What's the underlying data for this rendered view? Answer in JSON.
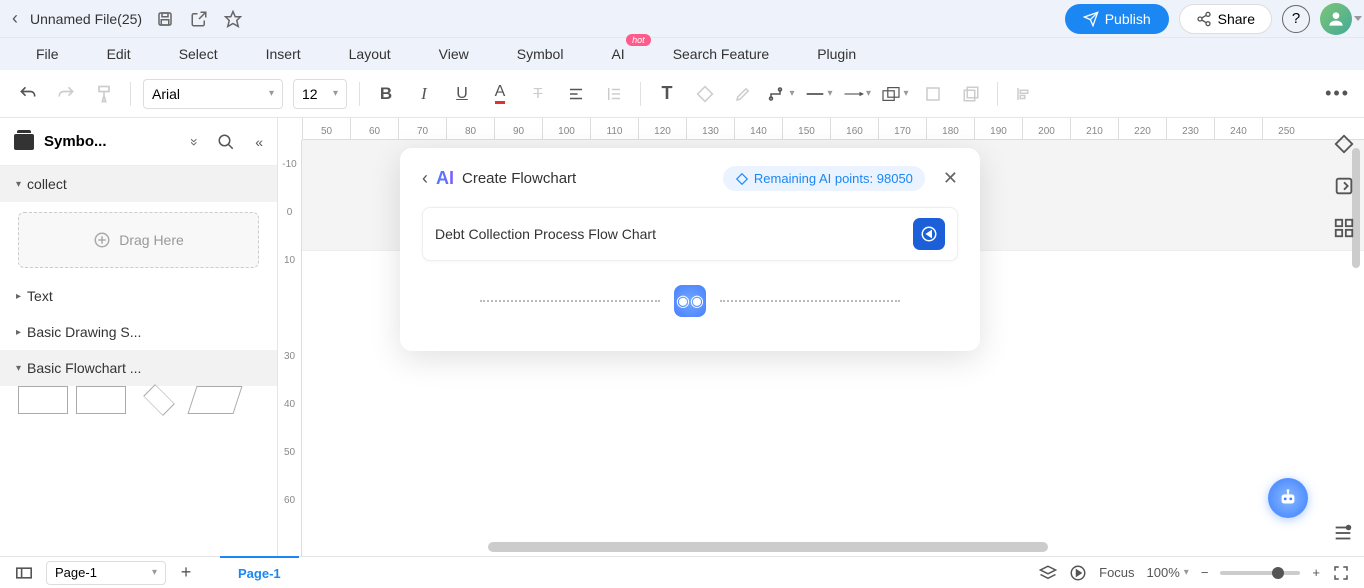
{
  "titlebar": {
    "filename": "Unnamed File(25)",
    "publish": "Publish",
    "share": "Share"
  },
  "menubar": {
    "items": [
      "File",
      "Edit",
      "Select",
      "Insert",
      "Layout",
      "View",
      "Symbol",
      "AI",
      "Search Feature",
      "Plugin"
    ],
    "hot_badge": "hot"
  },
  "toolbar": {
    "font": "Arial",
    "size": "12"
  },
  "sidebar": {
    "title": "Symbo...",
    "drag": "Drag Here",
    "sections": {
      "collect": "collect",
      "text": "Text",
      "basicdraw": "Basic Drawing S...",
      "basicflow": "Basic Flowchart ..."
    }
  },
  "ruler_h": [
    "50",
    "60",
    "70",
    "80",
    "90",
    "100",
    "110",
    "120",
    "130",
    "140",
    "150",
    "160",
    "170",
    "180",
    "190",
    "200",
    "210",
    "220",
    "230",
    "240",
    "250"
  ],
  "ruler_v": [
    "-10",
    "0",
    "10",
    "",
    "30",
    "40",
    "50",
    "60"
  ],
  "ai": {
    "logo": "AI",
    "title": "Create Flowchart",
    "points_label": "Remaining AI points: 98050",
    "input": "Debt Collection Process Flow Chart"
  },
  "status": {
    "page_dd": "Page-1",
    "page_tab": "Page-1",
    "focus": "Focus",
    "zoom": "100%"
  }
}
